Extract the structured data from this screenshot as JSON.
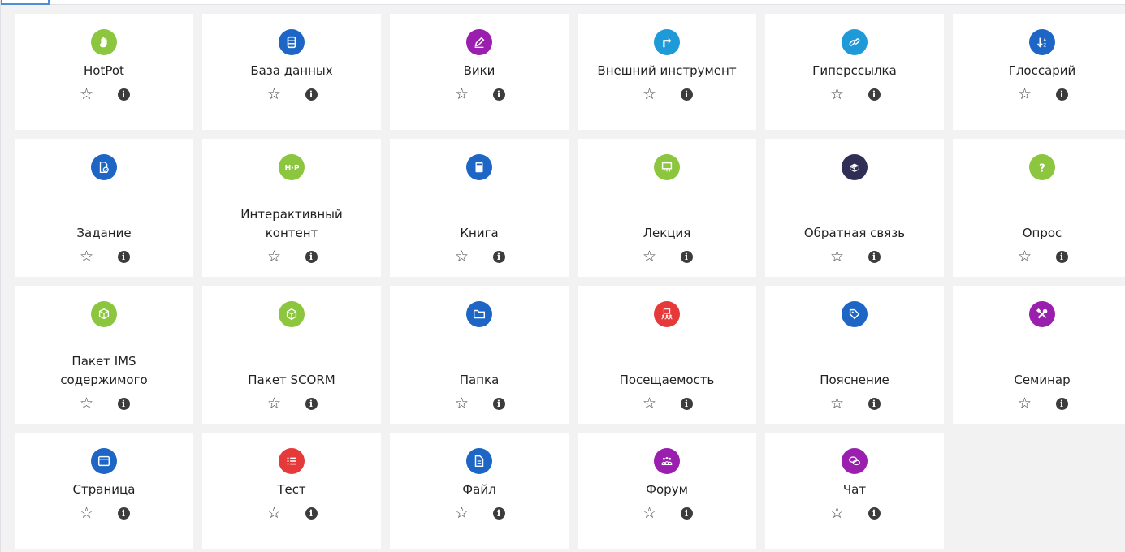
{
  "modules": [
    {
      "name": "HotPot",
      "icon": "hand-icon",
      "color": "#8cc63f"
    },
    {
      "name": "База данных",
      "icon": "database-icon",
      "color": "#1e66c5"
    },
    {
      "name": "Вики",
      "icon": "pencil-icon",
      "color": "#9b1fae"
    },
    {
      "name": "Внешний инструмент",
      "icon": "external-tool-icon",
      "color": "#1f9ad8"
    },
    {
      "name": "Гиперссылка",
      "icon": "link-icon",
      "color": "#1f9ad8"
    },
    {
      "name": "Глоссарий",
      "icon": "sort-az-icon",
      "color": "#1e66c5"
    },
    {
      "name": "Задание",
      "icon": "assignment-icon",
      "color": "#1e66c5"
    },
    {
      "name": "Интерактивный контент",
      "icon": "h5p-icon",
      "color": "#8cc63f"
    },
    {
      "name": "Книга",
      "icon": "book-icon",
      "color": "#1e66c5"
    },
    {
      "name": "Лекция",
      "icon": "presentation-icon",
      "color": "#8cc63f"
    },
    {
      "name": "Обратная связь",
      "icon": "feedback-box-icon",
      "color": "#2f2f55"
    },
    {
      "name": "Опрос",
      "icon": "question-icon",
      "color": "#8cc63f"
    },
    {
      "name": "Пакет IMS содержимого",
      "icon": "package-icon",
      "color": "#8cc63f"
    },
    {
      "name": "Пакет SCORM",
      "icon": "scorm-package-icon",
      "color": "#8cc63f"
    },
    {
      "name": "Папка",
      "icon": "folder-icon",
      "color": "#1e66c5"
    },
    {
      "name": "Посещаемость",
      "icon": "attendance-icon",
      "color": "#e63a3a"
    },
    {
      "name": "Пояснение",
      "icon": "tag-icon",
      "color": "#1e66c5"
    },
    {
      "name": "Семинар",
      "icon": "tools-icon",
      "color": "#9b1fae"
    },
    {
      "name": "Страница",
      "icon": "page-icon",
      "color": "#1e66c5"
    },
    {
      "name": "Тест",
      "icon": "list-icon",
      "color": "#e63a3a"
    },
    {
      "name": "Файл",
      "icon": "file-icon",
      "color": "#1e66c5"
    },
    {
      "name": "Форум",
      "icon": "forum-icon",
      "color": "#9b1fae"
    },
    {
      "name": "Чат",
      "icon": "chat-icon",
      "color": "#9b1fae"
    }
  ],
  "labels": {
    "star": "☆",
    "info": "i"
  }
}
